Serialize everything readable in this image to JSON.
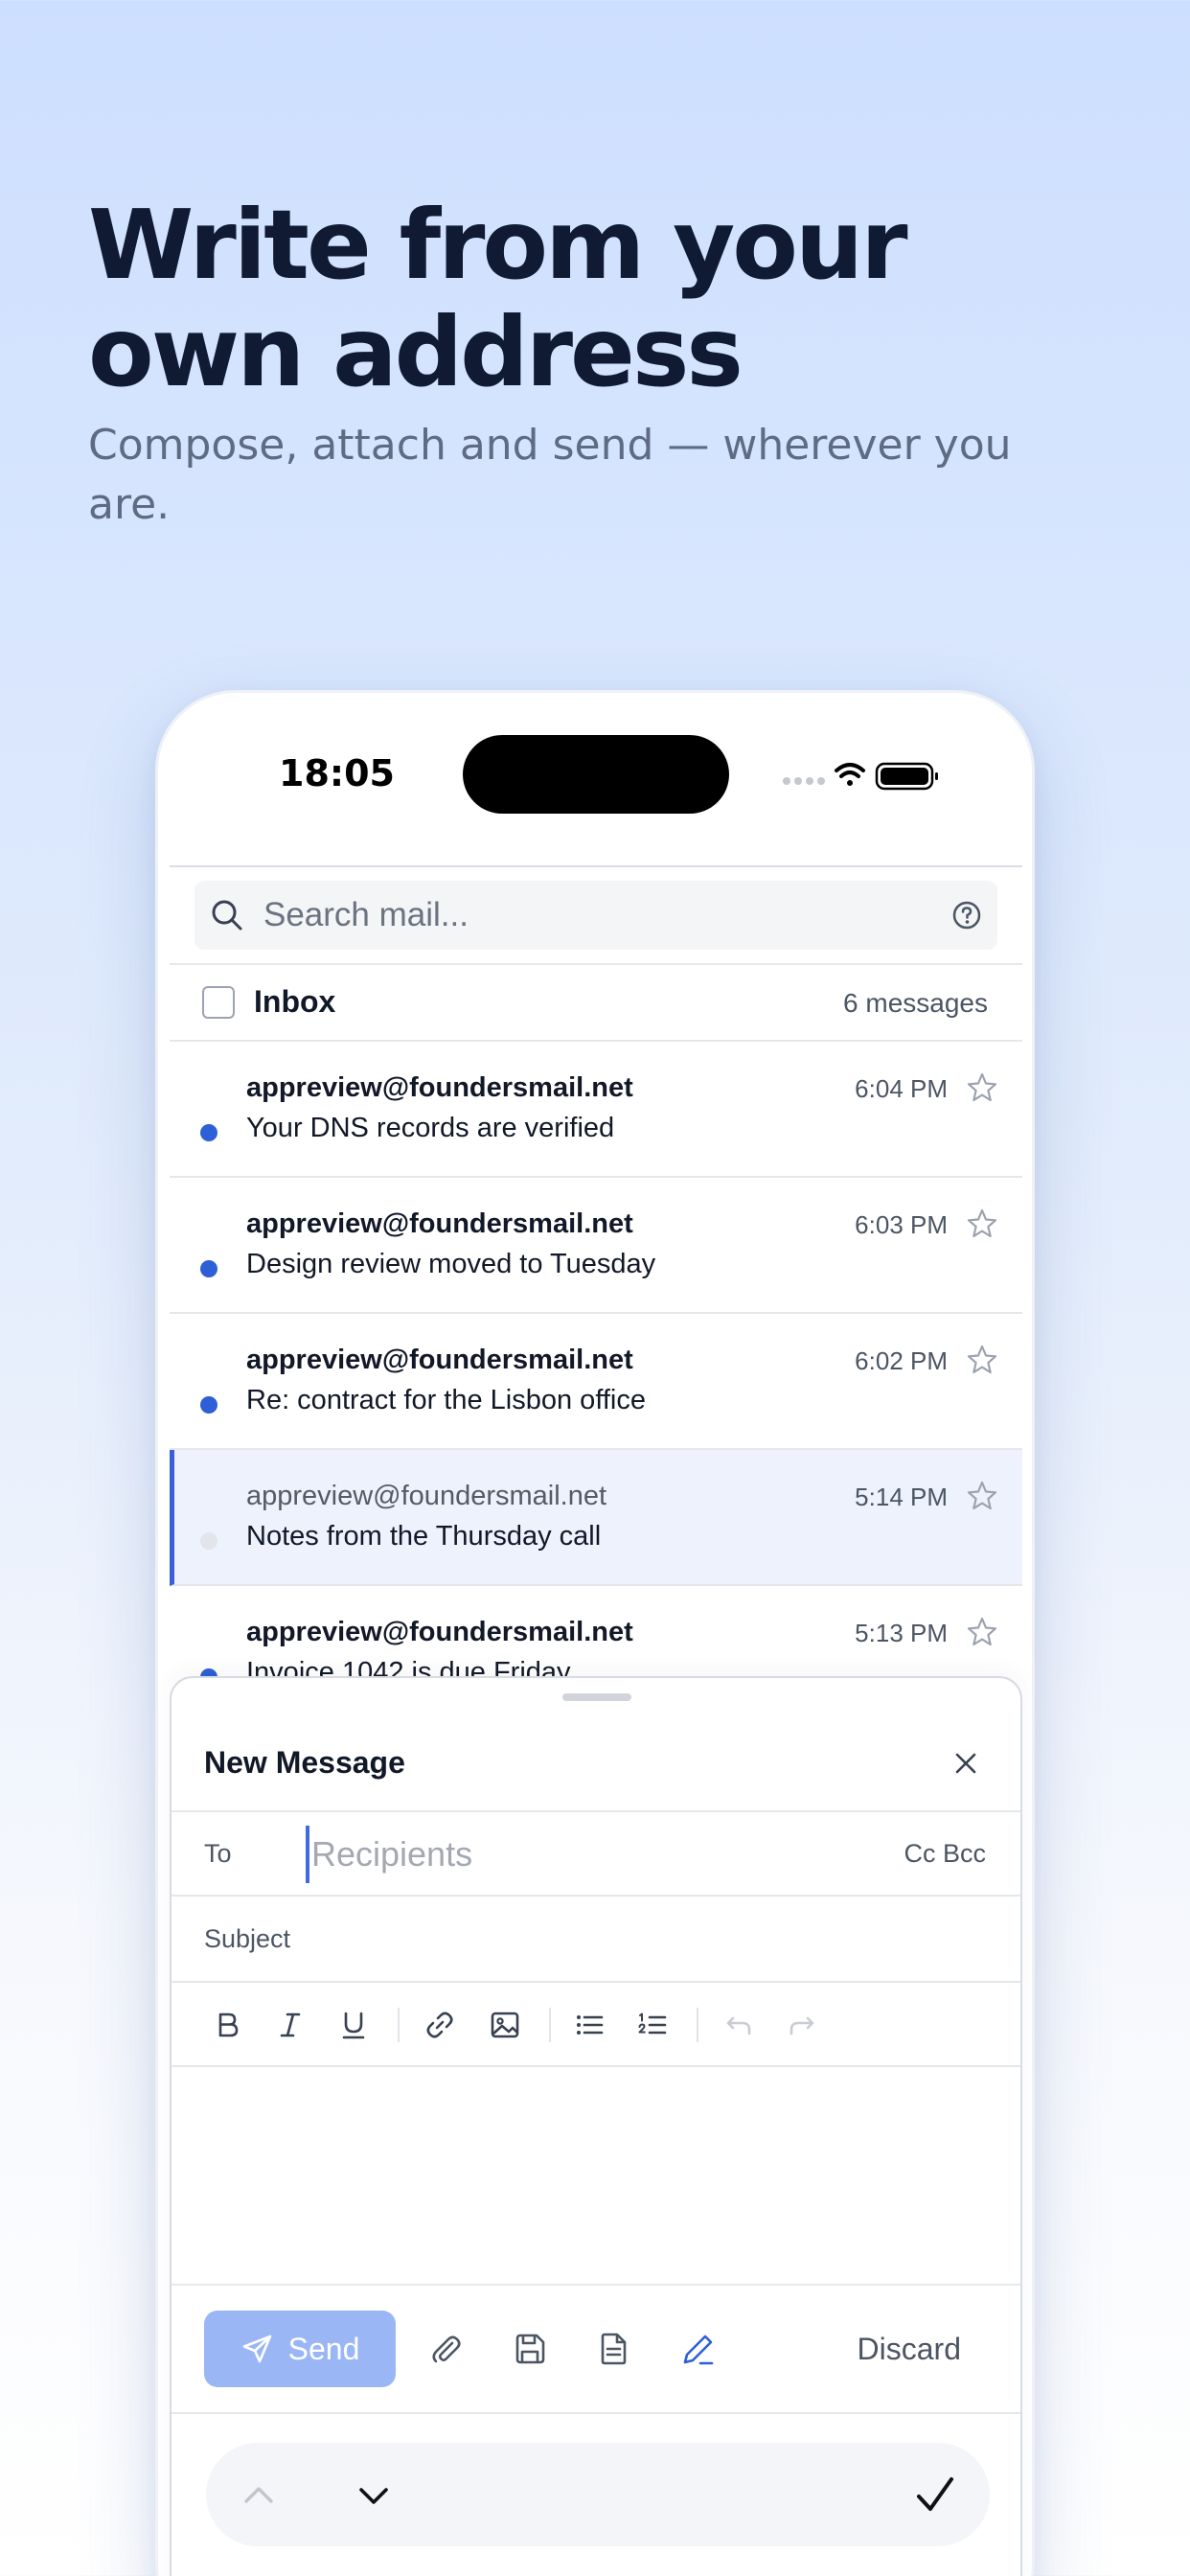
{
  "marketing": {
    "headline": "Write from your own address",
    "subhead": "Compose, attach and send — wherever you are."
  },
  "status_bar": {
    "time": "18:05"
  },
  "search": {
    "placeholder": "Search mail..."
  },
  "inbox": {
    "title": "Inbox",
    "count": "6 messages",
    "messages": [
      {
        "sender": "appreview@foundersmail.net",
        "subject": "Your DNS records are verified",
        "time": "6:04 PM",
        "unread": true
      },
      {
        "sender": "appreview@foundersmail.net",
        "subject": "Design review moved to Tuesday",
        "time": "6:03 PM",
        "unread": true
      },
      {
        "sender": "appreview@foundersmail.net",
        "subject": "Re: contract for the Lisbon office",
        "time": "6:02 PM",
        "unread": true
      },
      {
        "sender": "appreview@foundersmail.net",
        "subject": "Notes from the Thursday call",
        "time": "5:14 PM",
        "unread": false
      },
      {
        "sender": "appreview@foundersmail.net",
        "subject": "Invoice 1042 is due Friday",
        "time": "5:13 PM",
        "unread": true
      }
    ]
  },
  "composer": {
    "title": "New Message",
    "to_label": "To",
    "to_placeholder": "Recipients",
    "cc_bcc": "Cc Bcc",
    "subject_placeholder": "Subject",
    "send_label": "Send",
    "discard_label": "Discard"
  },
  "colors": {
    "accent": "#2e5fd6",
    "send_button": "#9bb6f5",
    "headline": "#101a33",
    "subhead": "#5f6b82"
  }
}
